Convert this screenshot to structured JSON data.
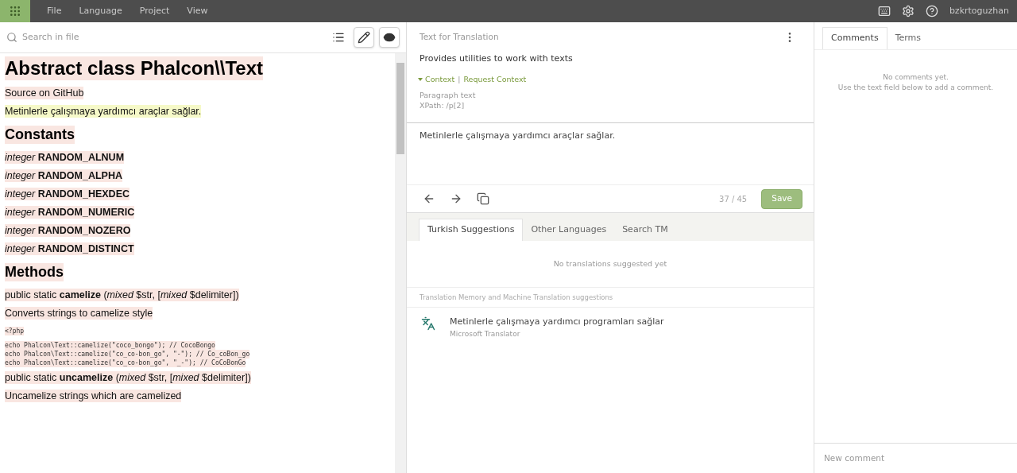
{
  "menu": [
    "File",
    "Language",
    "Project",
    "View"
  ],
  "user": "bzkrtoguzhan",
  "search": {
    "placeholder": "Search in file"
  },
  "view_toggles": [
    {
      "kind": "list",
      "selected": false
    },
    {
      "kind": "edit",
      "selected": true
    },
    {
      "kind": "preview",
      "selected": true
    }
  ],
  "document": [
    {
      "kind": "h1",
      "text": "Abstract class Phalcon\\\\Text",
      "current": false
    },
    {
      "kind": "p",
      "text": "Source on GitHub",
      "current": false
    },
    {
      "kind": "p",
      "text": "Metinlerle çalışmaya yardımcı araçlar sağlar.",
      "current": true
    },
    {
      "kind": "h2",
      "text": "Constants",
      "current": false
    },
    {
      "kind": "p",
      "text": "*integer* **RANDOM_ALNUM**",
      "current": false
    },
    {
      "kind": "p",
      "text": "*integer* **RANDOM_ALPHA**",
      "current": false
    },
    {
      "kind": "p",
      "text": "*integer* **RANDOM_HEXDEC**",
      "current": false
    },
    {
      "kind": "p",
      "text": "*integer* **RANDOM_NUMERIC**",
      "current": false
    },
    {
      "kind": "p",
      "text": "*integer* **RANDOM_NOZERO**",
      "current": false
    },
    {
      "kind": "p",
      "text": "*integer* **RANDOM_DISTINCT**",
      "current": false
    },
    {
      "kind": "h2",
      "text": "Methods",
      "current": false
    },
    {
      "kind": "p",
      "text": "public static **camelize** (*mixed* $str, [*mixed* $delimiter])",
      "current": false
    },
    {
      "kind": "p",
      "text": "Converts strings to camelize style",
      "current": false
    },
    {
      "kind": "code",
      "lines": [
        "<?php"
      ],
      "current": false
    },
    {
      "kind": "code",
      "lines": [
        "echo Phalcon\\Text::camelize(\"coco_bongo\"); // CocoBongo",
        "echo Phalcon\\Text::camelize(\"co_co-bon_go\", \"-\"); // Co_coBon_go",
        "echo Phalcon\\Text::camelize(\"co_co-bon_go\", \"_-\"); // CoCoBonGo"
      ],
      "current": false
    },
    {
      "kind": "p",
      "text": "public static **uncamelize** (*mixed* $str, [*mixed* $delimiter])",
      "current": false
    },
    {
      "kind": "p",
      "text": "Uncamelize strings which are camelized",
      "current": false
    }
  ],
  "editor": {
    "title": "Text for Translation",
    "source": "Provides utilities to work with texts",
    "context_link": "Context",
    "context_expanded": true,
    "context_separator": "|",
    "request_link": "Request Context",
    "context_lines": [
      "Paragraph text",
      "XPath: /p[2]"
    ],
    "translation": "Metinlerle çalışmaya yardımcı araçlar sağlar.",
    "counter": "37 / 45",
    "save": "Save"
  },
  "suggestion_tabs": [
    {
      "label": "Turkish Suggestions",
      "selected": true
    },
    {
      "label": "Other Languages",
      "selected": false
    },
    {
      "label": "Search TM",
      "selected": false
    }
  ],
  "no_suggestions": "No translations suggested yet",
  "machine_heading": "Translation Memory and Machine Translation suggestions",
  "machine_suggestions": [
    {
      "text": "Metinlerle çalışmaya yardımcı programları sağlar",
      "source": "Microsoft Translator"
    }
  ],
  "side_tabs": [
    {
      "label": "Comments",
      "selected": true
    },
    {
      "label": "Terms",
      "selected": false
    }
  ],
  "comments_empty": [
    "No comments yet.",
    "Use the text field below to add a comment."
  ],
  "new_comment": {
    "placeholder": "New comment"
  }
}
